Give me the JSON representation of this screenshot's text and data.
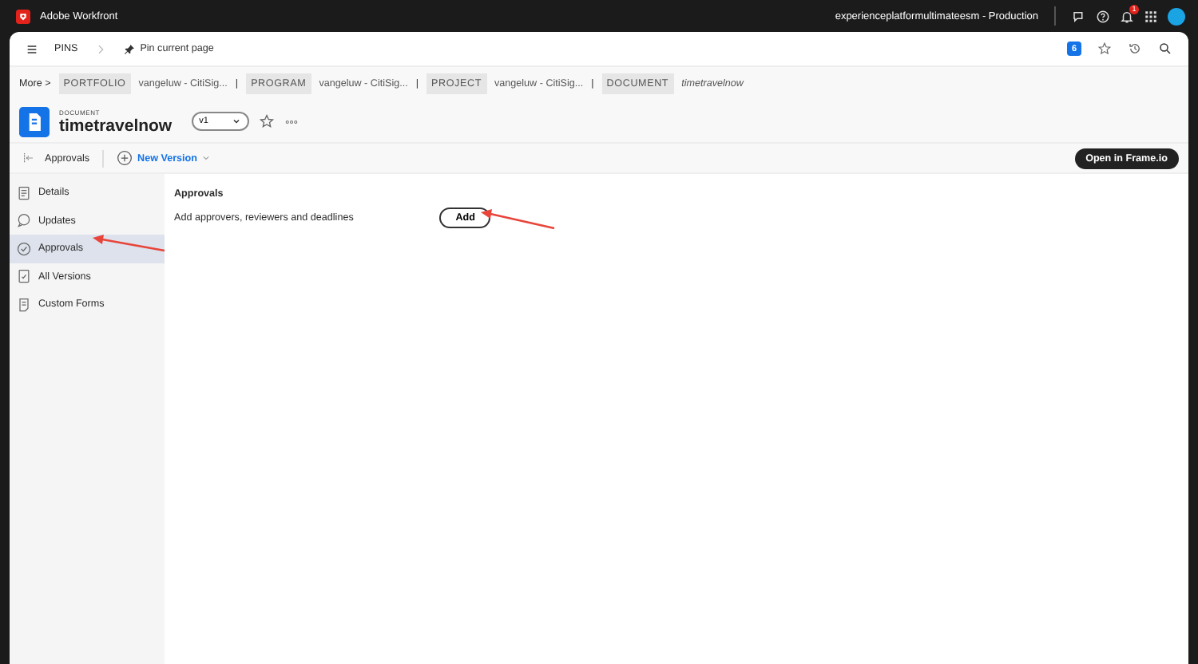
{
  "app": {
    "title": "Adobe Workfront",
    "org": "experienceplatformultimateesm - Production",
    "notification_count": "1"
  },
  "pins": {
    "label": "PINS",
    "pin_action": "Pin current page",
    "count": "6"
  },
  "breadcrumb": {
    "more": "More >",
    "items": [
      {
        "type": "PORTFOLIO",
        "name": "vangeluw - CitiSig...",
        "separator": "|"
      },
      {
        "type": "PROGRAM",
        "name": "vangeluw - CitiSig...",
        "separator": "|"
      },
      {
        "type": "PROJECT",
        "name": "vangeluw - CitiSig...",
        "separator": "|"
      },
      {
        "type": "DOCUMENT",
        "name": "timetravelnow"
      }
    ]
  },
  "document": {
    "type_label": "DOCUMENT",
    "name": "timetravelnow",
    "version": "v1"
  },
  "toolbar": {
    "section": "Approvals",
    "new_version": "New Version",
    "open_button": "Open in Frame.io"
  },
  "sidebar": {
    "items": [
      {
        "label": "Details",
        "selected": false
      },
      {
        "label": "Updates",
        "selected": false
      },
      {
        "label": "Approvals",
        "selected": true
      },
      {
        "label": "All Versions",
        "selected": false
      },
      {
        "label": "Custom Forms",
        "selected": false
      }
    ]
  },
  "content": {
    "title": "Approvals",
    "description": "Add approvers, reviewers and deadlines",
    "add_button": "Add"
  }
}
